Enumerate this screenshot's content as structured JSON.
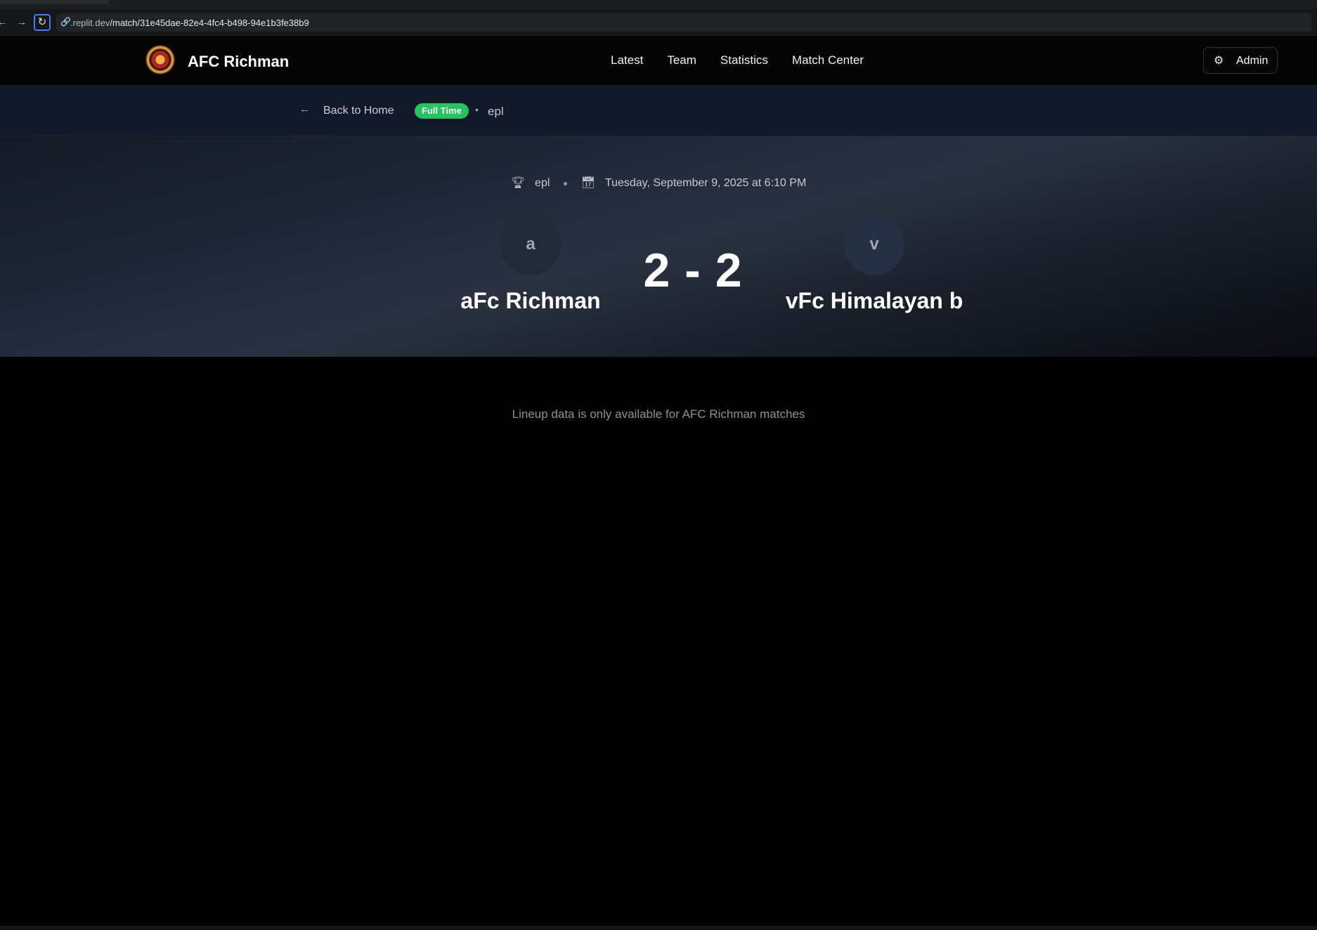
{
  "browser": {
    "url_host": ".replit.dev",
    "url_path": "/match/31e45dae-82e4-4fc4-b498-94e1b3fe38b9"
  },
  "header": {
    "brand": "AFC Richman",
    "nav": [
      "Latest",
      "Team",
      "Statistics",
      "Match Center"
    ],
    "admin_label": "Admin"
  },
  "subbar": {
    "back_label": "Back to Home",
    "status": "Full Time",
    "competition": "epl"
  },
  "match": {
    "competition": "epl",
    "datetime": "Tuesday, September 9, 2025 at 6:10 PM",
    "home": {
      "initial": "a",
      "name": "aFc Richman"
    },
    "away": {
      "initial": "v",
      "name": "vFc Himalayan b"
    },
    "score": "2 - 2"
  },
  "lineup_note": "Lineup data is only available for AFC Richman matches",
  "colors": {
    "status_badge": "#22c55e",
    "hero_gradient_mid": "#2a3241",
    "reload_focus": "#3b82f6"
  }
}
